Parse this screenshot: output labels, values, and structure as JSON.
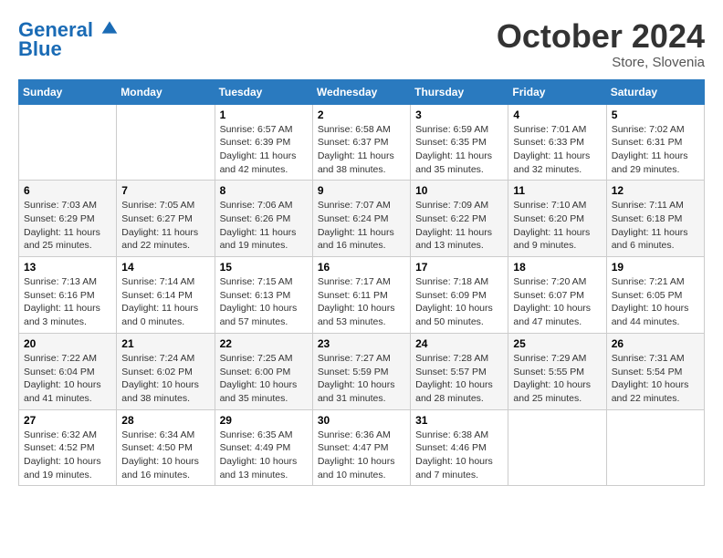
{
  "header": {
    "logo_line1": "General",
    "logo_line2": "Blue",
    "month": "October 2024",
    "location": "Store, Slovenia"
  },
  "weekdays": [
    "Sunday",
    "Monday",
    "Tuesday",
    "Wednesday",
    "Thursday",
    "Friday",
    "Saturday"
  ],
  "weeks": [
    [
      {
        "day": "",
        "sunrise": "",
        "sunset": "",
        "daylight": ""
      },
      {
        "day": "",
        "sunrise": "",
        "sunset": "",
        "daylight": ""
      },
      {
        "day": "1",
        "sunrise": "Sunrise: 6:57 AM",
        "sunset": "Sunset: 6:39 PM",
        "daylight": "Daylight: 11 hours and 42 minutes."
      },
      {
        "day": "2",
        "sunrise": "Sunrise: 6:58 AM",
        "sunset": "Sunset: 6:37 PM",
        "daylight": "Daylight: 11 hours and 38 minutes."
      },
      {
        "day": "3",
        "sunrise": "Sunrise: 6:59 AM",
        "sunset": "Sunset: 6:35 PM",
        "daylight": "Daylight: 11 hours and 35 minutes."
      },
      {
        "day": "4",
        "sunrise": "Sunrise: 7:01 AM",
        "sunset": "Sunset: 6:33 PM",
        "daylight": "Daylight: 11 hours and 32 minutes."
      },
      {
        "day": "5",
        "sunrise": "Sunrise: 7:02 AM",
        "sunset": "Sunset: 6:31 PM",
        "daylight": "Daylight: 11 hours and 29 minutes."
      }
    ],
    [
      {
        "day": "6",
        "sunrise": "Sunrise: 7:03 AM",
        "sunset": "Sunset: 6:29 PM",
        "daylight": "Daylight: 11 hours and 25 minutes."
      },
      {
        "day": "7",
        "sunrise": "Sunrise: 7:05 AM",
        "sunset": "Sunset: 6:27 PM",
        "daylight": "Daylight: 11 hours and 22 minutes."
      },
      {
        "day": "8",
        "sunrise": "Sunrise: 7:06 AM",
        "sunset": "Sunset: 6:26 PM",
        "daylight": "Daylight: 11 hours and 19 minutes."
      },
      {
        "day": "9",
        "sunrise": "Sunrise: 7:07 AM",
        "sunset": "Sunset: 6:24 PM",
        "daylight": "Daylight: 11 hours and 16 minutes."
      },
      {
        "day": "10",
        "sunrise": "Sunrise: 7:09 AM",
        "sunset": "Sunset: 6:22 PM",
        "daylight": "Daylight: 11 hours and 13 minutes."
      },
      {
        "day": "11",
        "sunrise": "Sunrise: 7:10 AM",
        "sunset": "Sunset: 6:20 PM",
        "daylight": "Daylight: 11 hours and 9 minutes."
      },
      {
        "day": "12",
        "sunrise": "Sunrise: 7:11 AM",
        "sunset": "Sunset: 6:18 PM",
        "daylight": "Daylight: 11 hours and 6 minutes."
      }
    ],
    [
      {
        "day": "13",
        "sunrise": "Sunrise: 7:13 AM",
        "sunset": "Sunset: 6:16 PM",
        "daylight": "Daylight: 11 hours and 3 minutes."
      },
      {
        "day": "14",
        "sunrise": "Sunrise: 7:14 AM",
        "sunset": "Sunset: 6:14 PM",
        "daylight": "Daylight: 11 hours and 0 minutes."
      },
      {
        "day": "15",
        "sunrise": "Sunrise: 7:15 AM",
        "sunset": "Sunset: 6:13 PM",
        "daylight": "Daylight: 10 hours and 57 minutes."
      },
      {
        "day": "16",
        "sunrise": "Sunrise: 7:17 AM",
        "sunset": "Sunset: 6:11 PM",
        "daylight": "Daylight: 10 hours and 53 minutes."
      },
      {
        "day": "17",
        "sunrise": "Sunrise: 7:18 AM",
        "sunset": "Sunset: 6:09 PM",
        "daylight": "Daylight: 10 hours and 50 minutes."
      },
      {
        "day": "18",
        "sunrise": "Sunrise: 7:20 AM",
        "sunset": "Sunset: 6:07 PM",
        "daylight": "Daylight: 10 hours and 47 minutes."
      },
      {
        "day": "19",
        "sunrise": "Sunrise: 7:21 AM",
        "sunset": "Sunset: 6:05 PM",
        "daylight": "Daylight: 10 hours and 44 minutes."
      }
    ],
    [
      {
        "day": "20",
        "sunrise": "Sunrise: 7:22 AM",
        "sunset": "Sunset: 6:04 PM",
        "daylight": "Daylight: 10 hours and 41 minutes."
      },
      {
        "day": "21",
        "sunrise": "Sunrise: 7:24 AM",
        "sunset": "Sunset: 6:02 PM",
        "daylight": "Daylight: 10 hours and 38 minutes."
      },
      {
        "day": "22",
        "sunrise": "Sunrise: 7:25 AM",
        "sunset": "Sunset: 6:00 PM",
        "daylight": "Daylight: 10 hours and 35 minutes."
      },
      {
        "day": "23",
        "sunrise": "Sunrise: 7:27 AM",
        "sunset": "Sunset: 5:59 PM",
        "daylight": "Daylight: 10 hours and 31 minutes."
      },
      {
        "day": "24",
        "sunrise": "Sunrise: 7:28 AM",
        "sunset": "Sunset: 5:57 PM",
        "daylight": "Daylight: 10 hours and 28 minutes."
      },
      {
        "day": "25",
        "sunrise": "Sunrise: 7:29 AM",
        "sunset": "Sunset: 5:55 PM",
        "daylight": "Daylight: 10 hours and 25 minutes."
      },
      {
        "day": "26",
        "sunrise": "Sunrise: 7:31 AM",
        "sunset": "Sunset: 5:54 PM",
        "daylight": "Daylight: 10 hours and 22 minutes."
      }
    ],
    [
      {
        "day": "27",
        "sunrise": "Sunrise: 6:32 AM",
        "sunset": "Sunset: 4:52 PM",
        "daylight": "Daylight: 10 hours and 19 minutes."
      },
      {
        "day": "28",
        "sunrise": "Sunrise: 6:34 AM",
        "sunset": "Sunset: 4:50 PM",
        "daylight": "Daylight: 10 hours and 16 minutes."
      },
      {
        "day": "29",
        "sunrise": "Sunrise: 6:35 AM",
        "sunset": "Sunset: 4:49 PM",
        "daylight": "Daylight: 10 hours and 13 minutes."
      },
      {
        "day": "30",
        "sunrise": "Sunrise: 6:36 AM",
        "sunset": "Sunset: 4:47 PM",
        "daylight": "Daylight: 10 hours and 10 minutes."
      },
      {
        "day": "31",
        "sunrise": "Sunrise: 6:38 AM",
        "sunset": "Sunset: 4:46 PM",
        "daylight": "Daylight: 10 hours and 7 minutes."
      },
      {
        "day": "",
        "sunrise": "",
        "sunset": "",
        "daylight": ""
      },
      {
        "day": "",
        "sunrise": "",
        "sunset": "",
        "daylight": ""
      }
    ]
  ]
}
